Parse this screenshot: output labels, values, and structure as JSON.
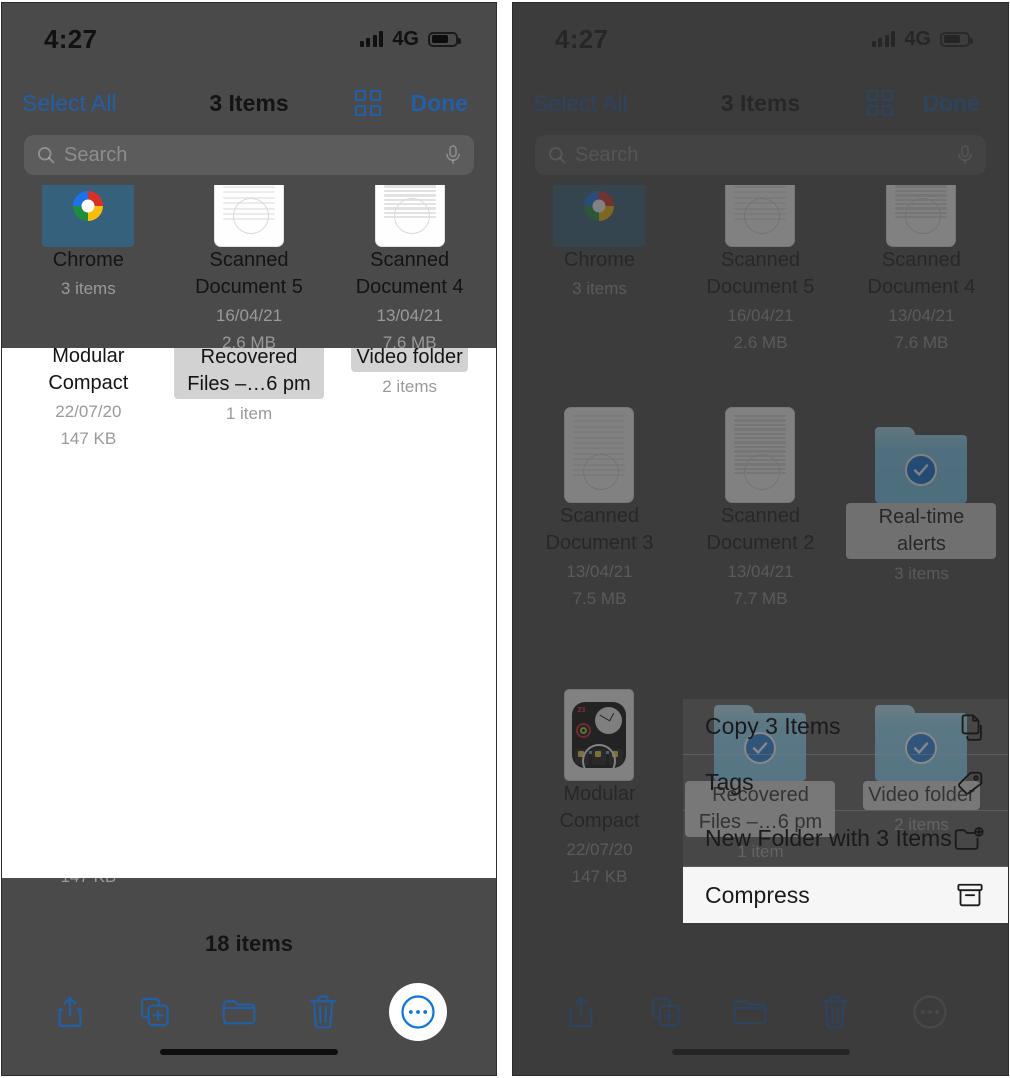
{
  "status_bar": {
    "time": "4:27",
    "network": "4G",
    "signal_icon": "cellular-bars-icon",
    "battery_icon": "battery-icon"
  },
  "nav_bar": {
    "select_all": "Select All",
    "title": "3 Items",
    "grid_icon": "grid-view-icon",
    "done": "Done"
  },
  "search": {
    "placeholder": "Search",
    "search_icon": "search-icon",
    "mic_icon": "microphone-icon"
  },
  "files": {
    "row_top": [
      {
        "name": "Chrome",
        "date": "",
        "size": "",
        "sub": "3 items",
        "kind": "folder-chrome",
        "selected": false
      },
      {
        "name": "Scanned\nDocument 5",
        "date": "16/04/21",
        "size": "2.6 MB",
        "sub": "",
        "kind": "doc",
        "selected": false
      },
      {
        "name": "Scanned\nDocument 4",
        "date": "13/04/21",
        "size": "7.6 MB",
        "sub": "",
        "kind": "doc",
        "selected": false
      }
    ],
    "row_mid": [
      {
        "name": "Scanned Document 3",
        "date": "13/04/21",
        "size": "7.5 MB",
        "sub": "",
        "kind": "doc",
        "selected": false
      },
      {
        "name": "Scanned Document 2",
        "date": "13/04/21",
        "size": "7.7 MB",
        "sub": "",
        "kind": "doc",
        "selected": false
      },
      {
        "name": "Real-time alerts",
        "date": "",
        "size": "",
        "sub": "3 items",
        "kind": "folder",
        "selected": true
      }
    ],
    "row_bot": [
      {
        "name": "Modular Compact",
        "date": "22/07/20",
        "size": "147 KB",
        "sub": "",
        "kind": "watch",
        "selected": false
      },
      {
        "name": "Recovered Files –…6 pm",
        "date": "",
        "size": "",
        "sub": "1 item",
        "kind": "folder",
        "selected": true
      },
      {
        "name": "Video folder",
        "date": "",
        "size": "",
        "sub": "2 items",
        "kind": "folder",
        "selected": true
      }
    ]
  },
  "bottom_bar": {
    "item_count": "18 items",
    "actions": [
      {
        "name": "share-button",
        "icon": "share-icon"
      },
      {
        "name": "duplicate-button",
        "icon": "duplicate-icon"
      },
      {
        "name": "move-button",
        "icon": "folder-icon"
      },
      {
        "name": "delete-button",
        "icon": "trash-icon"
      },
      {
        "name": "more-button",
        "icon": "ellipsis-circle-icon"
      }
    ]
  },
  "context_menu": {
    "items": [
      {
        "label": "Copy 3 Items",
        "icon": "copy-icon",
        "active": false
      },
      {
        "label": "Tags",
        "icon": "tag-icon",
        "active": false
      },
      {
        "label": "New Folder with 3 Items",
        "icon": "new-folder-icon",
        "active": false
      },
      {
        "label": "Compress",
        "icon": "archive-icon",
        "active": true
      }
    ]
  },
  "colors": {
    "accent_blue": "#215fa6",
    "folder_blue": "#7fd2f7",
    "check_blue": "#0b72da",
    "dim_overlay": "#343434",
    "highlight_bg": "#ffffff",
    "selection_label_bg": "#d2d2d2"
  }
}
